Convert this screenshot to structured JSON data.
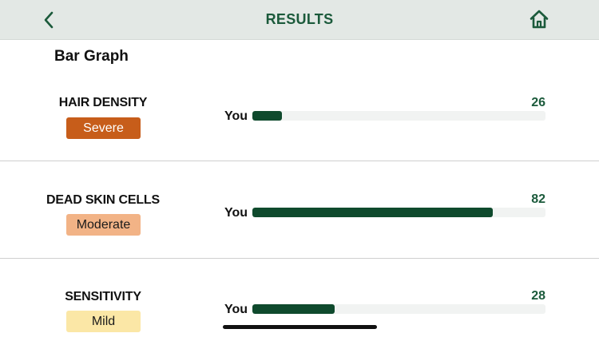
{
  "header": {
    "title": "RESULTS",
    "back_icon": "chevron-left-icon",
    "home_icon": "home-icon",
    "accent_color": "#1b5a3b",
    "background_color": "#e3e8e5"
  },
  "section_title": "Bar Graph",
  "bar_color": "#0f4a2d",
  "metrics": [
    {
      "name": "HAIR DENSITY",
      "severity": "Severe",
      "severity_bg": "#c75d1a",
      "severity_fg": "#ffffff",
      "you_label": "You",
      "score": "26",
      "bar_fill_fraction": 0.1
    },
    {
      "name": "DEAD SKIN CELLS",
      "severity": "Moderate",
      "severity_bg": "#f2b386",
      "severity_fg": "#1a1a1a",
      "you_label": "You",
      "score": "82",
      "bar_fill_fraction": 0.82
    },
    {
      "name": "SENSITIVITY",
      "severity": "Mild",
      "severity_bg": "#fbe7a6",
      "severity_fg": "#1a1a1a",
      "you_label": "You",
      "score": "28",
      "bar_fill_fraction": 0.28
    }
  ]
}
